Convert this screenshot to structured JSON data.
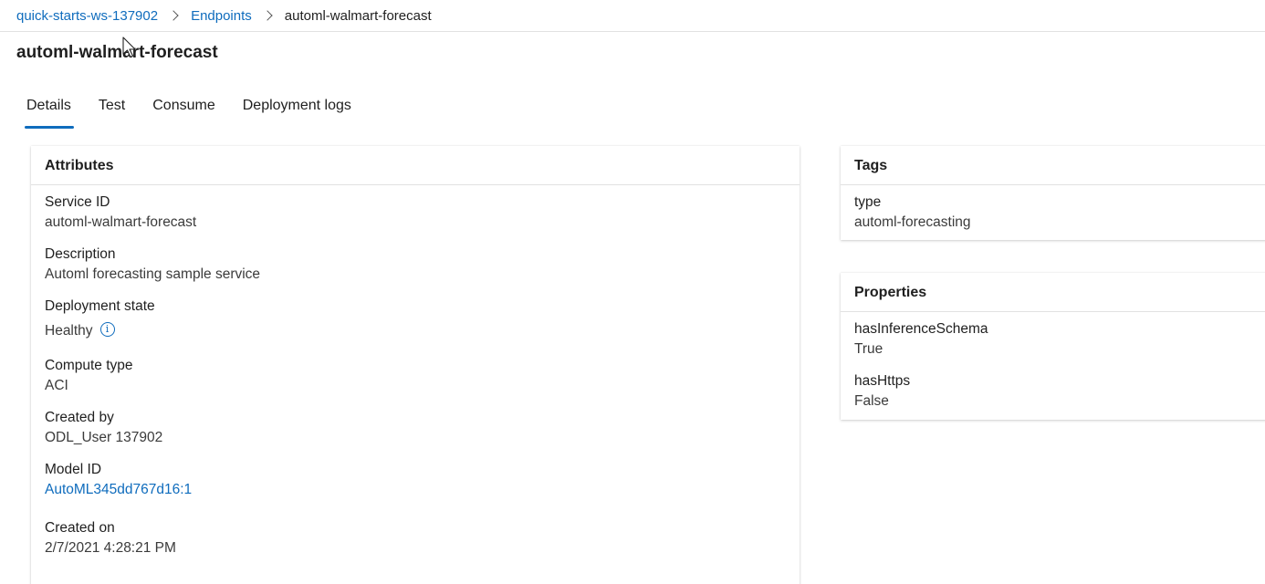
{
  "breadcrumb": {
    "workspace": "quick-starts-ws-137902",
    "section": "Endpoints",
    "current": "automl-walmart-forecast"
  },
  "page": {
    "title": "automl-walmart-forecast"
  },
  "tabs": [
    {
      "label": "Details",
      "active": true
    },
    {
      "label": "Test",
      "active": false
    },
    {
      "label": "Consume",
      "active": false
    },
    {
      "label": "Deployment logs",
      "active": false
    }
  ],
  "attributes": {
    "header": "Attributes",
    "service_id": {
      "label": "Service ID",
      "value": "automl-walmart-forecast"
    },
    "description": {
      "label": "Description",
      "value": "Automl forecasting sample service"
    },
    "deployment_state": {
      "label": "Deployment state",
      "value": "Healthy"
    },
    "compute_type": {
      "label": "Compute type",
      "value": "ACI"
    },
    "created_by": {
      "label": "Created by",
      "value": "ODL_User 137902"
    },
    "model_id": {
      "label": "Model ID",
      "value": "AutoML345dd767d16:1"
    },
    "created_on": {
      "label": "Created on",
      "value": "2/7/2021 4:28:21 PM"
    }
  },
  "tags": {
    "header": "Tags",
    "items": [
      {
        "key": "type",
        "value": "automl-forecasting"
      }
    ]
  },
  "properties": {
    "header": "Properties",
    "items": [
      {
        "key": "hasInferenceSchema",
        "value": "True"
      },
      {
        "key": "hasHttps",
        "value": "False"
      }
    ]
  },
  "icons": {
    "info": "info-icon",
    "chevron": "chevron-right-icon"
  },
  "colors": {
    "link": "#0f6cbd",
    "tab_indicator": "#0f6cbd",
    "divider": "#e1e1e1"
  }
}
